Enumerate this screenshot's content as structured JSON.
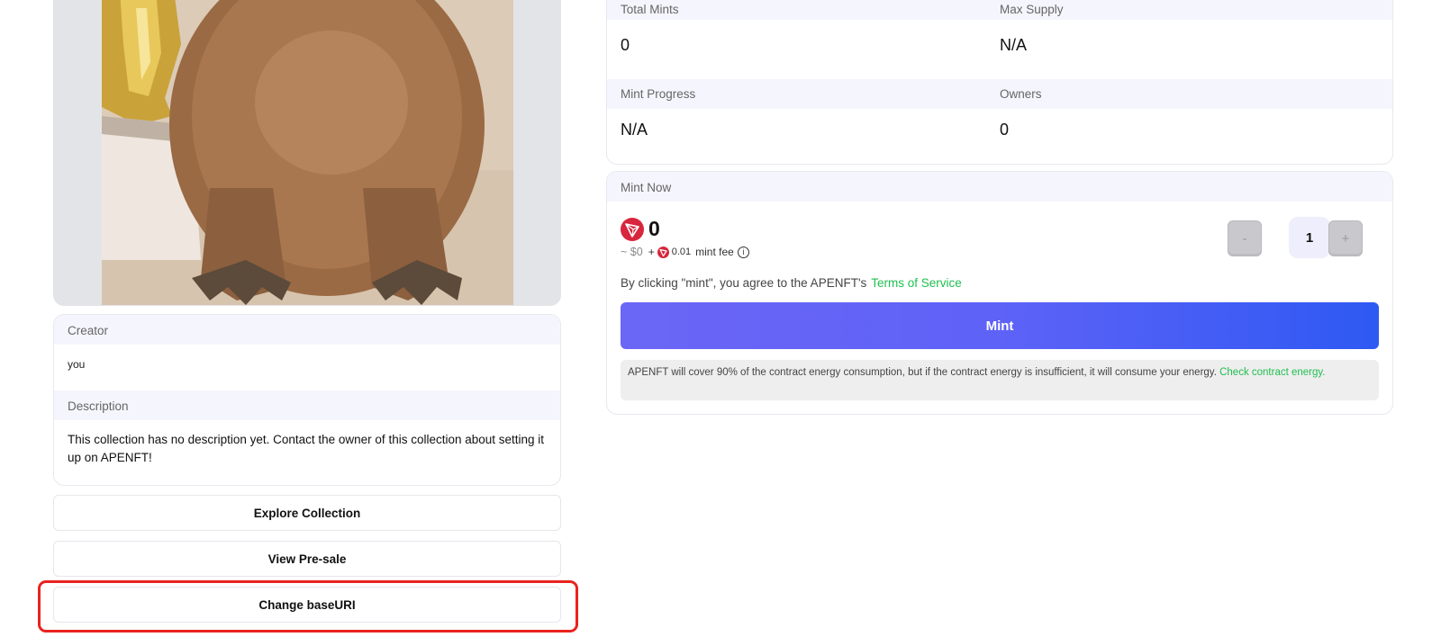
{
  "collection": {
    "creator_label": "Creator",
    "creator_value": "you",
    "description_label": "Description",
    "description_text": "This collection has no description yet. Contact the owner of this collection about setting it up on APENFT!"
  },
  "actions": {
    "explore": "Explore Collection",
    "presale": "View Pre-sale",
    "change_base_uri": "Change baseURI"
  },
  "stats": {
    "total_mints_label": "Total Mints",
    "total_mints_value": "0",
    "max_supply_label": "Max Supply",
    "max_supply_value": "N/A",
    "mint_progress_label": "Mint Progress",
    "mint_progress_value": "N/A",
    "owners_label": "Owners",
    "owners_value": "0"
  },
  "mint": {
    "heading": "Mint Now",
    "price": "0",
    "usd_estimate": "~ $0",
    "fee_prefix": "+",
    "fee_amount": "0.01",
    "fee_label": "mint fee",
    "decrement_label": "-",
    "increment_label": "+",
    "quantity": "1",
    "terms_text": "By clicking \"mint\", you agree to the APENFT's",
    "terms_link": "Terms of Service",
    "mint_button": "Mint",
    "energy_note": "APENFT will cover 90% of the contract energy consumption, but if the contract energy is insufficient, it will consume your energy.",
    "energy_link": "Check contract energy."
  },
  "colors": {
    "accent_green": "#1fbf4f",
    "mint_gradient_start": "#6b66f6",
    "mint_gradient_end": "#2e59f3",
    "highlight_red": "#e8231f",
    "tron_red": "#d7263d"
  },
  "icons": {
    "currency": "tron-icon",
    "info": "info-icon"
  }
}
